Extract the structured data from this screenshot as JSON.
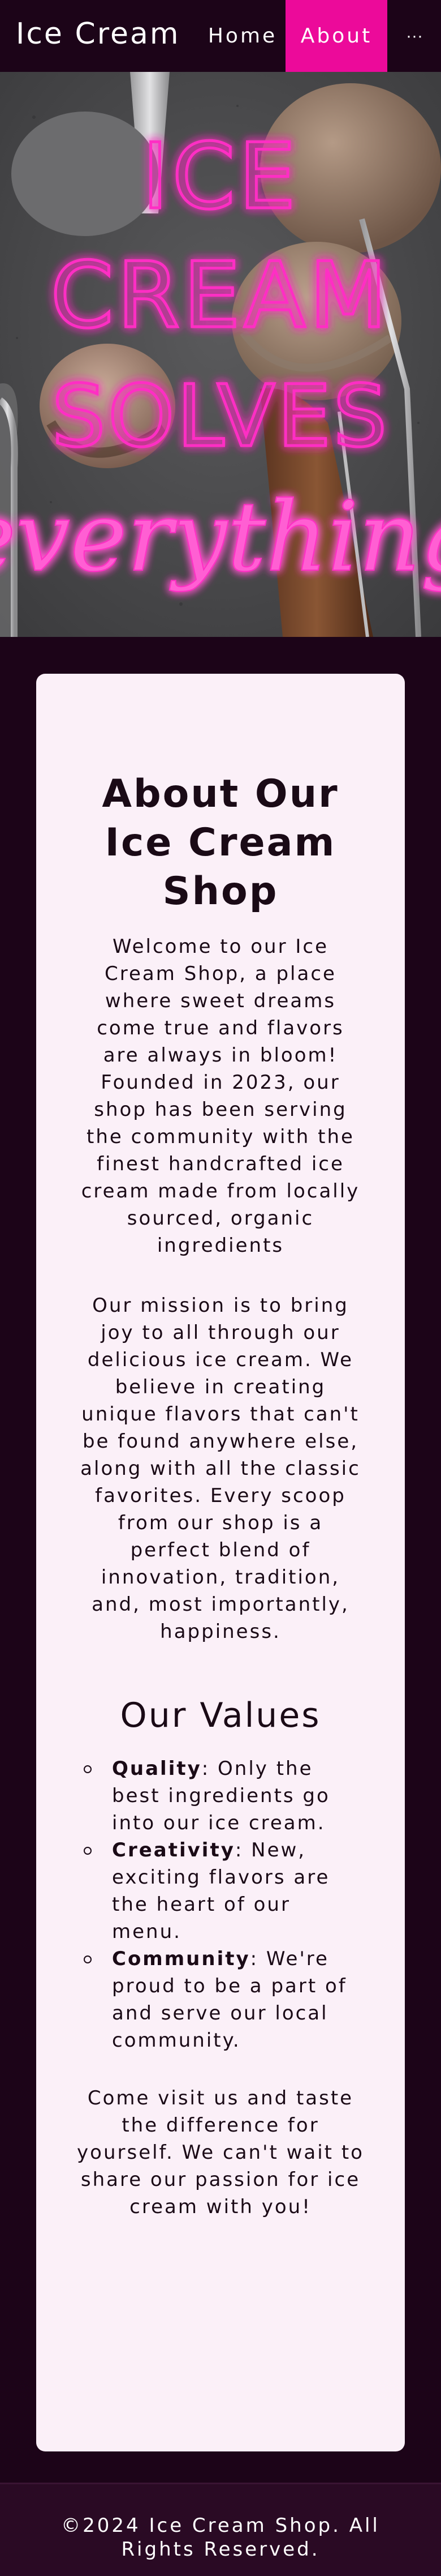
{
  "nav": {
    "brand": "Ice Cream",
    "items": [
      {
        "label": "Home",
        "active": false
      },
      {
        "label": "About",
        "active": true
      }
    ],
    "more_icon": "ellipsis-icon",
    "more_label": "···"
  },
  "hero": {
    "sign_lines": [
      "ICE",
      "CREAM",
      "SOLVES"
    ],
    "sign_script": "everything",
    "neon_color": "#ff2fc4"
  },
  "about": {
    "title": "About Our Ice Cream Shop",
    "intro": "Welcome to our Ice Cream Shop, a place where sweet dreams come true and flavors are always in bloom! Founded in 2023, our shop has been serving the community with the finest handcrafted ice cream made from locally sourced, organic ingredients",
    "mission": "Our mission is to bring joy to all through our delicious ice cream. We believe in creating unique flavors that can't be found anywhere else, along with all the classic favorites. Every scoop from our shop is a perfect blend of innovation, tradition, and, most importantly, happiness.",
    "values_title": "Our Values",
    "values": [
      {
        "name": "Quality",
        "text": ": Only the best ingredients go into our ice cream."
      },
      {
        "name": "Creativity",
        "text": ": New, exciting flavors are the heart of our menu."
      },
      {
        "name": "Community",
        "text": ": We're proud to be a part of and serve our local community."
      }
    ],
    "closing": "Come visit us and taste the difference for yourself. We can't wait to share our passion for ice cream with you!"
  },
  "footer": {
    "line1": "©2024 Ice Cream Shop. All",
    "line2": "Rights Reserved."
  },
  "colors": {
    "accent": "#ec0a9a",
    "background": "#1c0418",
    "card": "#fbf0f8"
  }
}
